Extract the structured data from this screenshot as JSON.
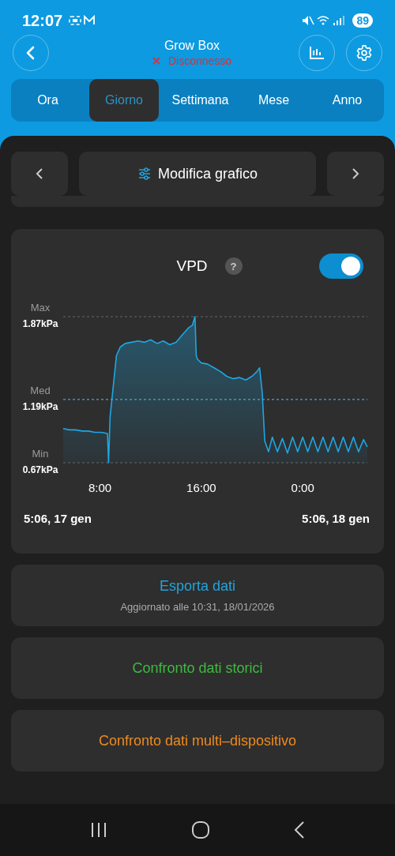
{
  "status_bar": {
    "time": "12:07",
    "battery": "89"
  },
  "header": {
    "title": "Grow Box",
    "connection": {
      "connected": false,
      "label": "Disconnesso"
    }
  },
  "tabs": [
    {
      "label": "Ora",
      "selected": false
    },
    {
      "label": "Giorno",
      "selected": true
    },
    {
      "label": "Settimana",
      "selected": false
    },
    {
      "label": "Mese",
      "selected": false
    },
    {
      "label": "Anno",
      "selected": false
    }
  ],
  "chart_nav": {
    "edit_label": "Modifica grafico"
  },
  "chart_card": {
    "help": "?",
    "enabled": true,
    "tick_names": [
      "Max",
      "Med",
      "Min"
    ],
    "chart_data": {
      "type": "area",
      "x": [
        5.1,
        5.6,
        6.1,
        6.6,
        7.1,
        7.6,
        8.1,
        8.6,
        8.68,
        8.8,
        9.0,
        9.3,
        9.6,
        10,
        10.5,
        11,
        11.5,
        12,
        12.5,
        13,
        13.5,
        14,
        14.5,
        15,
        15.3,
        15.5,
        15.6,
        15.7,
        16,
        16.5,
        17,
        17.5,
        18,
        18.5,
        19,
        19.5,
        20,
        20.4,
        20.6,
        20.8,
        21,
        21.3,
        21.6,
        22,
        22.4,
        22.8,
        23.2,
        23.6,
        24,
        24.4,
        24.8,
        25.2,
        25.6,
        26,
        26.4,
        26.8,
        27.2,
        27.6,
        28,
        28.4,
        28.8,
        29.1
      ],
      "series": [
        {
          "name": "VPD",
          "color": "#1ea7e4",
          "values": [
            0.95,
            0.94,
            0.94,
            0.93,
            0.93,
            0.92,
            0.92,
            0.91,
            0.67,
            1.05,
            1.25,
            1.55,
            1.62,
            1.65,
            1.66,
            1.67,
            1.66,
            1.68,
            1.65,
            1.67,
            1.64,
            1.66,
            1.72,
            1.78,
            1.8,
            1.87,
            1.55,
            1.52,
            1.49,
            1.48,
            1.45,
            1.42,
            1.38,
            1.36,
            1.37,
            1.35,
            1.38,
            1.42,
            1.45,
            1.25,
            0.85,
            0.76,
            0.88,
            0.76,
            0.87,
            0.75,
            0.88,
            0.76,
            0.88,
            0.76,
            0.88,
            0.76,
            0.88,
            0.76,
            0.88,
            0.76,
            0.88,
            0.76,
            0.88,
            0.76,
            0.86,
            0.8
          ]
        }
      ],
      "ref_lines": [
        {
          "axis": "y",
          "value": 1.19
        }
      ],
      "xlim": [
        5.1,
        29.1
      ],
      "ylim": [
        0.67,
        1.87
      ],
      "xticks": [
        {
          "value": 8,
          "label": "8:00"
        },
        {
          "value": 16,
          "label": "16:00"
        },
        {
          "value": 24,
          "label": "0:00"
        }
      ],
      "yticks": [
        {
          "value": 1.87,
          "label": "1.87kPa"
        },
        {
          "value": 1.19,
          "label": "1.19kPa"
        },
        {
          "value": 0.67,
          "label": "0.67kPa"
        }
      ]
    },
    "range_start": "5:06,  17 gen",
    "range_end": "5:06,  18 gen"
  },
  "actions": [
    {
      "kind": "export",
      "label": "Esporta dati",
      "note": "Aggiornato alle 10:31,  18/01/2026"
    },
    {
      "kind": "history",
      "label": "Confronto dati storici"
    },
    {
      "kind": "multi",
      "label": "Confronto dati multi–dispositivo"
    }
  ]
}
